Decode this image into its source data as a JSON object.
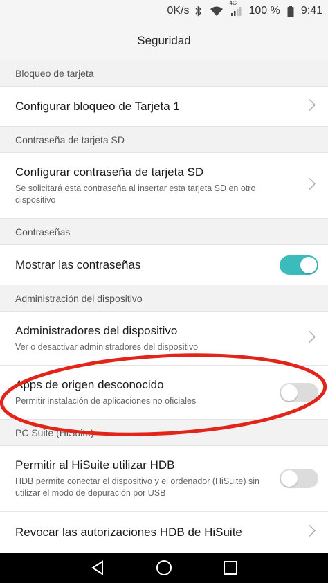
{
  "status_bar": {
    "speed": "0K/s",
    "network": "4G",
    "battery": "100 %",
    "time": "9:41"
  },
  "title": "Seguridad",
  "sections": {
    "card_lock": {
      "header": "Bloqueo de tarjeta",
      "item": {
        "title": "Configurar bloqueo de Tarjeta 1"
      }
    },
    "sd_password": {
      "header": "Contraseña de tarjeta SD",
      "item": {
        "title": "Configurar contraseña de tarjeta SD",
        "subtitle": "Se solicitará esta contraseña al insertar esta tarjeta SD en otro dispositivo"
      }
    },
    "passwords": {
      "header": "Contraseñas",
      "item": {
        "title": "Mostrar las contraseñas",
        "toggle": true
      }
    },
    "device_admin": {
      "header": "Administración del dispositivo",
      "items": [
        {
          "title": "Administradores del dispositivo",
          "subtitle": "Ver o desactivar administradores del dispositivo"
        },
        {
          "title": "Apps de origen desconocido",
          "subtitle": "Permitir instalación de aplicaciones no oficiales",
          "toggle": false
        }
      ]
    },
    "pc_suite": {
      "header": "PC Suite (HiSuite)",
      "items": [
        {
          "title": "Permitir al HiSuite utilizar HDB",
          "subtitle": "HDB permite conectar el dispositivo y el ordenador (HiSuite) sin utilizar el modo de depuración por USB",
          "toggle": false
        },
        {
          "title": "Revocar las autorizaciones HDB de HiSuite"
        }
      ]
    }
  },
  "colors": {
    "accent": "#3bbcbc",
    "annotation": "#e1251b",
    "header_bg": "#f2f2f2"
  },
  "icons": {
    "chevron": "chevron-right-icon",
    "back": "back-icon",
    "home": "home-icon",
    "recents": "recents-icon"
  }
}
